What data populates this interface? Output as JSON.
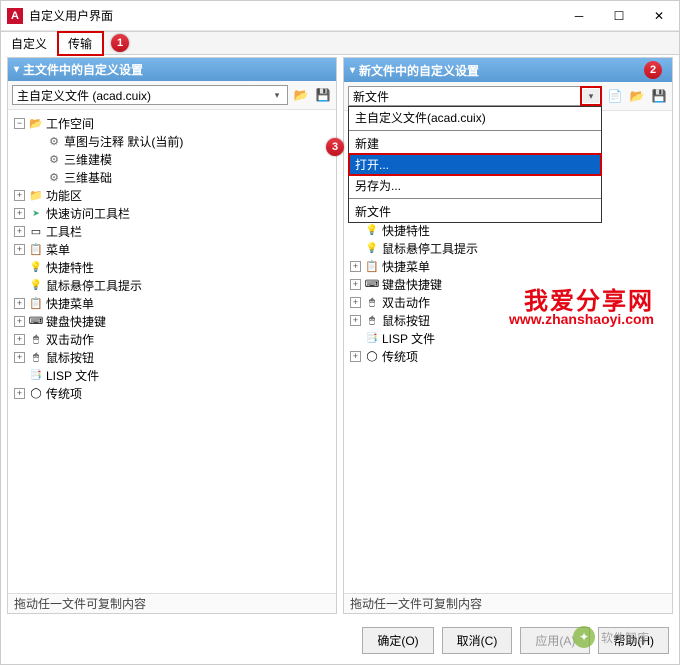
{
  "window": {
    "title": "自定义用户界面"
  },
  "tabs": {
    "tab1": "自定义",
    "tab2": "传输"
  },
  "callouts": {
    "c1": "1",
    "c2": "2",
    "c3": "3"
  },
  "left": {
    "header": "主文件中的自定义设置",
    "combo": "主自定义文件 (acad.cuix)",
    "footer": "拖动任一文件可复制内容",
    "tree": {
      "root": "工作空间",
      "n_draft": "草图与注释 默认(当前)",
      "n_3dmodel": "三维建模",
      "n_3dbasic": "三维基础",
      "n_func": "功能区",
      "n_quick": "快速访问工具栏",
      "n_toolbar": "工具栏",
      "n_menu": "菜单",
      "n_qprop": "快捷特性",
      "n_hover": "鼠标悬停工具提示",
      "n_qmenu": "快捷菜单",
      "n_keys": "键盘快捷键",
      "n_dbl": "双击动作",
      "n_mouse": "鼠标按钮",
      "n_lisp": "LISP 文件",
      "n_legacy": "传统项"
    }
  },
  "right": {
    "header": "新文件中的自定义设置",
    "combo": "新文件",
    "footer": "拖动任一文件可复制内容",
    "dropdown": {
      "opt_main": "主自定义文件(acad.cuix)",
      "opt_new": "新建",
      "opt_open": "打开...",
      "opt_saveas": "另存为...",
      "opt_newfile": "新文件"
    },
    "tree": {
      "n_qprop": "快捷特性",
      "n_hover": "鼠标悬停工具提示",
      "n_qmenu": "快捷菜单",
      "n_keys": "键盘快捷键",
      "n_dbl": "双击动作",
      "n_mouse": "鼠标按钮",
      "n_lisp": "LISP 文件",
      "n_legacy": "传统项"
    }
  },
  "buttons": {
    "ok": "确定(O)",
    "cancel": "取消(C)",
    "apply": "应用(A)",
    "help": "帮助(H)"
  },
  "watermark": {
    "line1": "我爱分享网",
    "line2": "www.zhanshaoyi.com",
    "footer": "软件智库"
  }
}
